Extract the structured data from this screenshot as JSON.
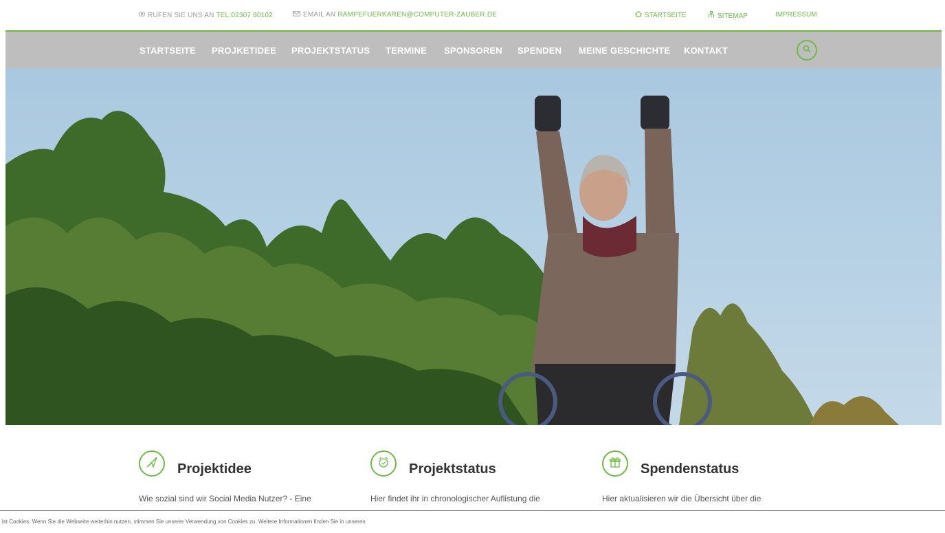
{
  "topbar": {
    "phone_prefix": "RUFEN SIE UNS AN",
    "phone_value": "TEL:02307 80102",
    "email_prefix": "EMAIL AN",
    "email_value": "RAMPEFUERKAREN@COMPUTER-ZAUBER.DE",
    "links": [
      "STARTSEITE",
      "SITEMAP",
      "IMPRESSUM"
    ]
  },
  "nav": {
    "items": [
      "STARTSEITE",
      "PROJKETIDEE",
      "PROJEKTSTATUS",
      "TERMINE",
      "SPONSOREN",
      "SPENDEN",
      "MEINE GESCHICHTE",
      "KONTAKT"
    ]
  },
  "features": [
    {
      "title": "Projektidee",
      "text": "Wie sozial sind wir Social Media Nutzer? - Eine",
      "icon": "paper-plane-icon"
    },
    {
      "title": "Projektstatus",
      "text": "Hier findet ihr in chronologischer Auflistung die",
      "icon": "alarm-clock-icon"
    },
    {
      "title": "Spendenstatus",
      "text": "Hier aktualisieren wir die Übersicht über die",
      "icon": "gift-icon"
    }
  ],
  "cookie": {
    "message": "lst Cookies. Wenn Sie die Webseite weiterhin nutzen, stimmen Sie unserer Verwendung von Cookies zu. Weitere Informationen finden Sie in unseren"
  },
  "colors": {
    "accent": "#6dbb45",
    "nav_bg": "#bebebe"
  }
}
